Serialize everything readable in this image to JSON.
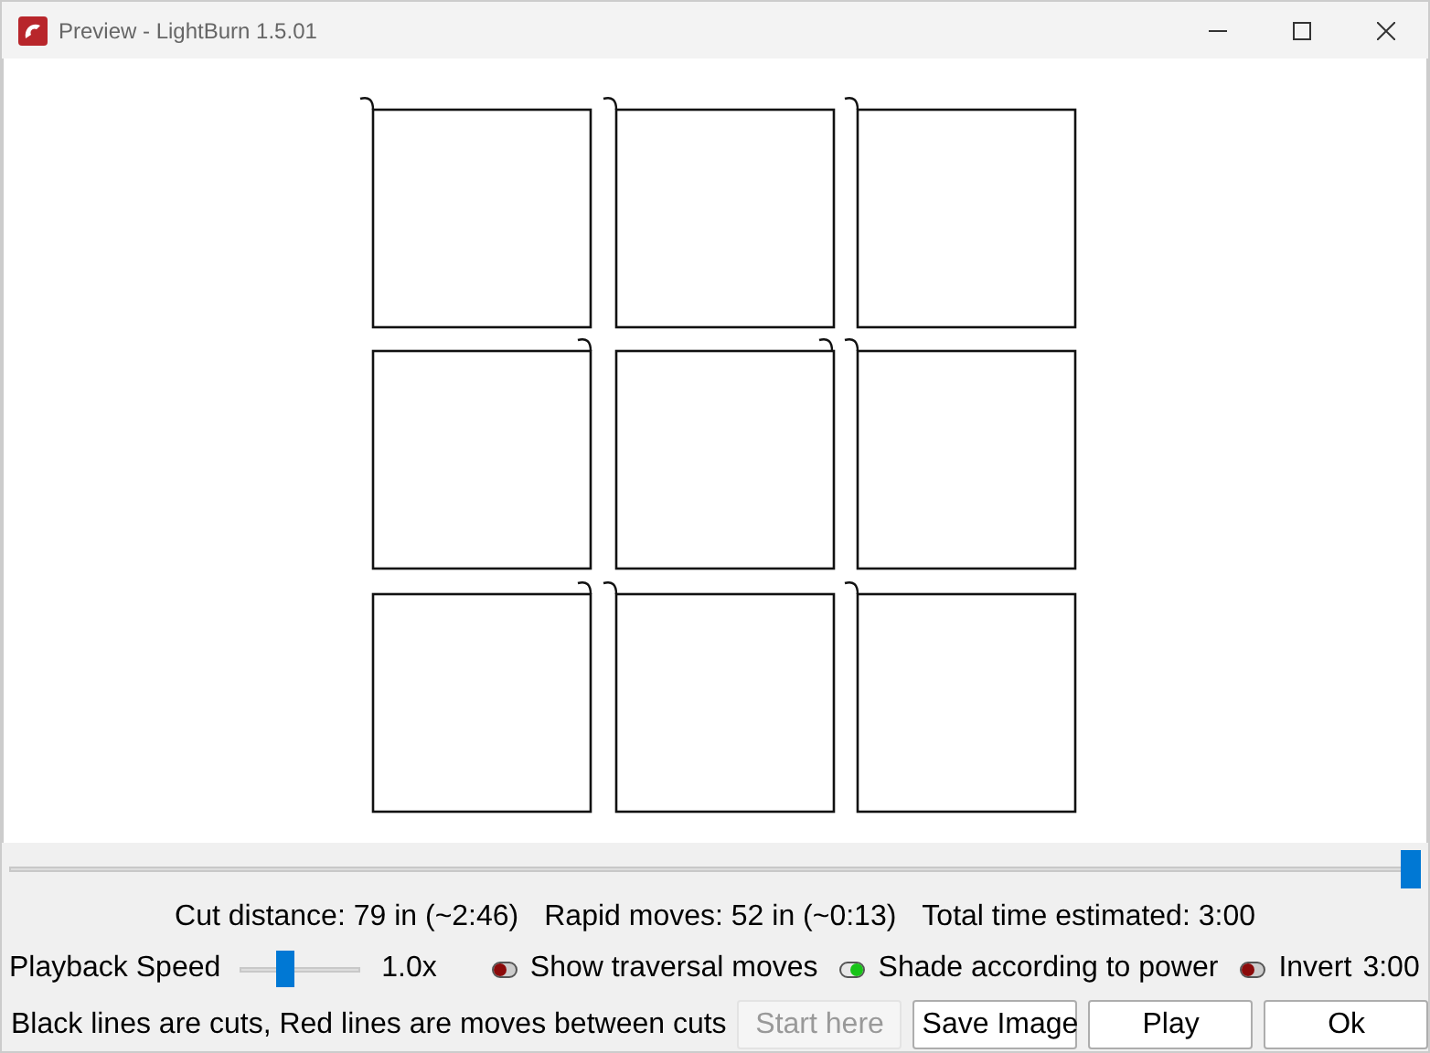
{
  "window": {
    "title": "Preview - LightBurn 1.5.01"
  },
  "timeline": {
    "level": 1.0
  },
  "stats": {
    "cut_distance": "Cut distance: 79 in (~2:46)",
    "rapid_moves": "Rapid moves: 52 in (~0:13)",
    "total_time": "Total time estimated: 3:00"
  },
  "playback": {
    "label": "Playback Speed",
    "level": 0.38,
    "reading": "1.0x"
  },
  "toggles": [
    {
      "label": "Show traversal moves",
      "on": false
    },
    {
      "label": "Shade according to power",
      "on": true
    },
    {
      "label": "Invert",
      "on": false
    }
  ],
  "elapsed": "3:00",
  "legend": "Black lines are cuts, Red lines are moves between cuts",
  "buttons": [
    {
      "label": "Start here",
      "disabled": true
    },
    {
      "label": "Save Image",
      "disabled": false
    },
    {
      "label": "Play",
      "disabled": false
    },
    {
      "label": "Ok",
      "disabled": false
    }
  ]
}
